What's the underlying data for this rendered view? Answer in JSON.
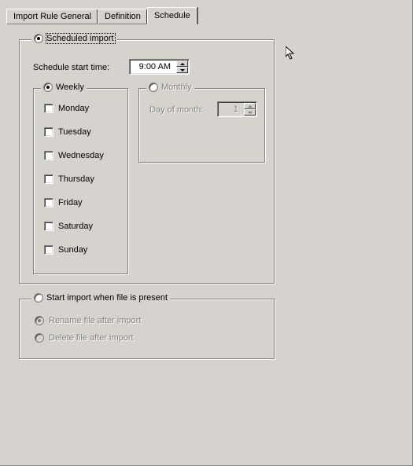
{
  "tabs": {
    "items": [
      {
        "label": "Import Rule General"
      },
      {
        "label": "Definition"
      },
      {
        "label": "Schedule"
      }
    ],
    "active_index": 2
  },
  "schedule": {
    "mode_scheduled": {
      "label": "Scheduled import",
      "selected": true
    },
    "start_time": {
      "label": "Schedule start time:",
      "value": "9:00 AM"
    },
    "weekly": {
      "label": "Weekly",
      "selected": true,
      "days": [
        {
          "label": "Monday",
          "checked": false
        },
        {
          "label": "Tuesday",
          "checked": false
        },
        {
          "label": "Wednesday",
          "checked": false
        },
        {
          "label": "Thursday",
          "checked": false
        },
        {
          "label": "Friday",
          "checked": false
        },
        {
          "label": "Saturday",
          "checked": false
        },
        {
          "label": "Sunday",
          "checked": false
        }
      ]
    },
    "monthly": {
      "label": "Monthly",
      "selected": false,
      "day_label": "Day of month:",
      "day_value": "1"
    },
    "mode_file_present": {
      "label": "Start import when file is present",
      "selected": false,
      "rename": {
        "label": "Rename file after import",
        "selected": true
      },
      "delete": {
        "label": "Delete file after import",
        "selected": false
      }
    }
  }
}
